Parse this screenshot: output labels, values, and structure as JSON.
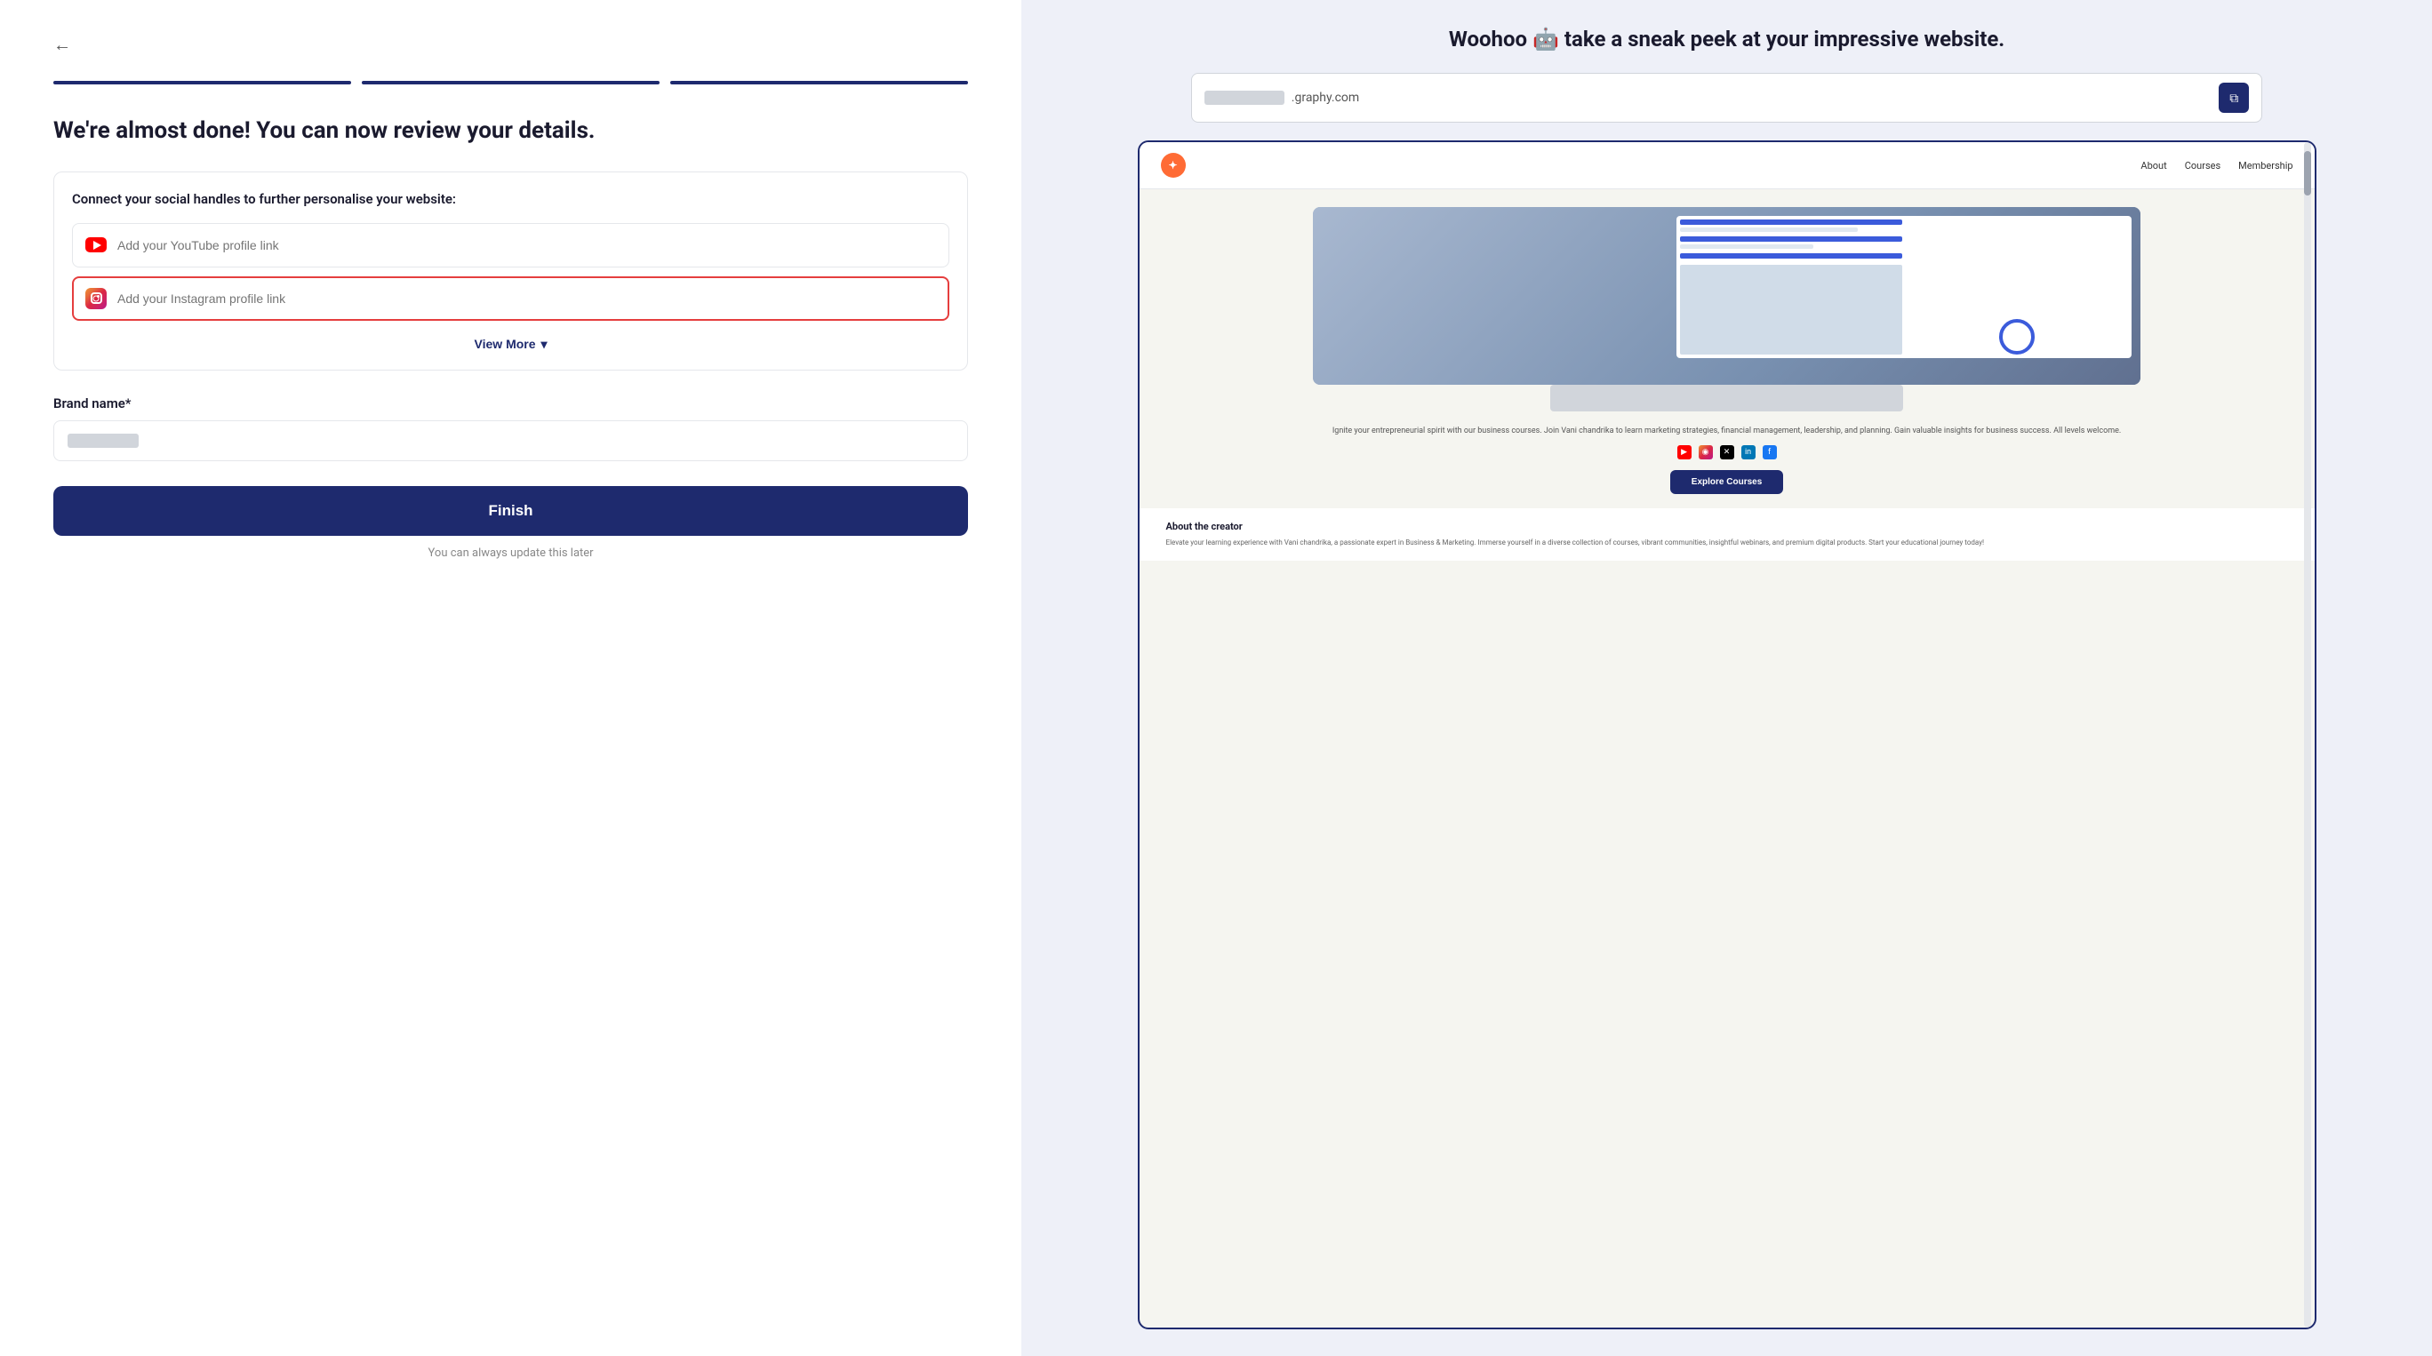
{
  "left": {
    "back_label": "←",
    "progress": [
      1,
      2,
      3
    ],
    "title": "We're almost done! You can now review your details.",
    "social_card": {
      "title": "Connect your social handles to further personalise your website:",
      "youtube": {
        "placeholder": "Add your YouTube profile link"
      },
      "instagram": {
        "placeholder": "Add your Instagram profile link"
      },
      "view_more_label": "View More"
    },
    "brand_label": "Brand name*",
    "finish_btn": "Finish",
    "footer_note": "You can always update this later"
  },
  "right": {
    "heading": "Woohoo 🤖 take a sneak peek at your impressive website.",
    "url_suffix": ".graphy.com",
    "nav_links": [
      "About",
      "Courses",
      "Membership"
    ],
    "description": "Ignite your entrepreneurial spirit with our business courses. Join Vani chandrika to learn marketing strategies, financial management, leadership, and planning. Gain valuable insights for business success. All levels welcome.",
    "cta_btn": "Explore Courses",
    "about_title": "About the creator",
    "about_text": "Elevate your learning experience with Vani chandrika, a passionate expert in Business & Marketing. Immerse yourself in a diverse collection of courses, vibrant communities, insightful webinars, and premium digital products. Start your educational journey today!"
  }
}
